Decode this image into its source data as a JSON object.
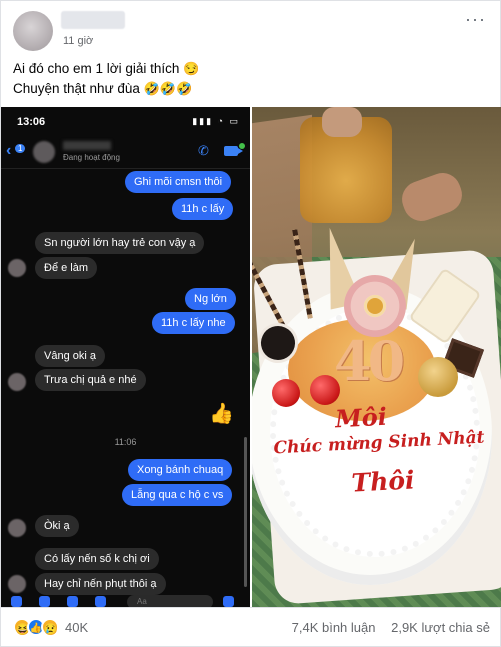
{
  "post": {
    "time": "11 giờ",
    "more_label": "···",
    "caption_line1": "Ai đó cho em 1 lời giải thích",
    "caption_line1_emoji": "😏",
    "caption_line2": "Chuyện thật như đùa",
    "caption_line2_emoji": "🤣🤣🤣"
  },
  "phone": {
    "status_time": "13:06",
    "status_icons": "▮▮▮ ◔ ▭",
    "back_badge": "1",
    "chat_status": "Đang hoạt động",
    "messages": [
      {
        "text": "Ghi mõi cmsn thôi"
      },
      {
        "text": "11h c lấy"
      },
      {
        "text": "Sn người lớn hay trẻ con vậy ạ"
      },
      {
        "text": "Để e làm"
      },
      {
        "text": "Ng lớn"
      },
      {
        "text": "11h c lấy nhe"
      },
      {
        "text": "Vâng oki ạ"
      },
      {
        "text": "Trưa chị quả e nhé"
      },
      {
        "text": "Xong bánh chuaq"
      },
      {
        "text": "Lẵng qua c hộ c vs"
      },
      {
        "text": "Òki ạ"
      },
      {
        "text": "Có lấy nến số k chị ơi"
      },
      {
        "text": "Hay chỉ nến phụt thôi ạ"
      }
    ],
    "divider_time": "11:06",
    "composer_placeholder": "Aa"
  },
  "cake": {
    "number": "40",
    "line1": "Môi",
    "line2": "Chúc mừng Sinh Nhật",
    "line3": "Thôi"
  },
  "footer": {
    "reaction_count": "40K",
    "comments": "7,4K bình luận",
    "shares": "2,9K lượt chia sẻ"
  },
  "colors": {
    "messenger_blue": "#2f6cf6",
    "facebook_blue": "#1877f2",
    "cake_writing_red": "#c71f1f"
  }
}
